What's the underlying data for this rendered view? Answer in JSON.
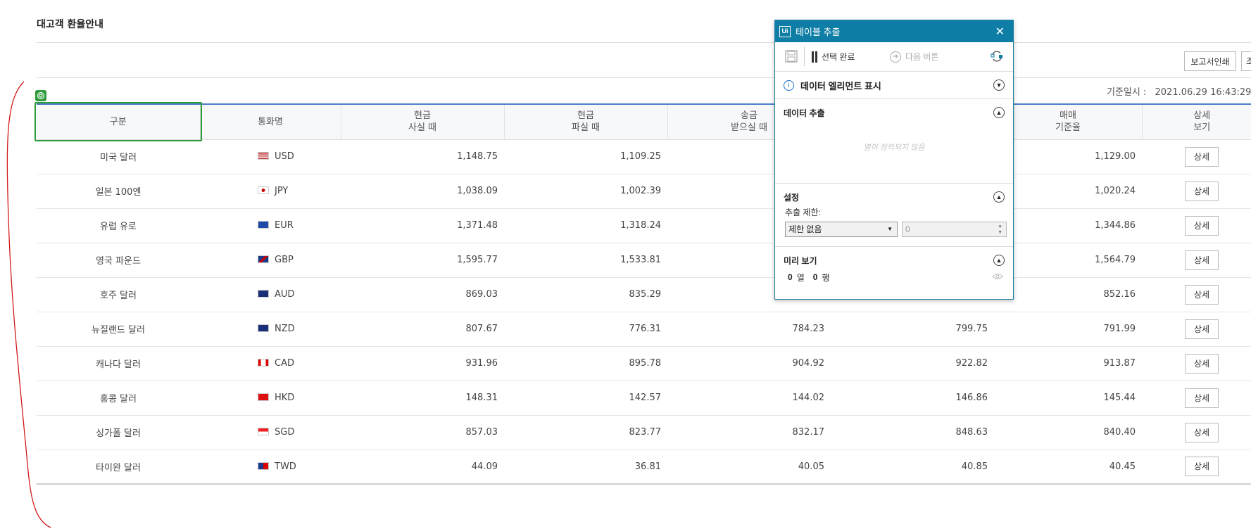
{
  "page": {
    "title": "대고객 환율안내",
    "print_button": "보고서인쇄",
    "cut_button": "조",
    "base_date_label": "기준일시 :",
    "base_date_value": "2021.06.29 16:43:29 ("
  },
  "table": {
    "headers": [
      {
        "line1": "구분",
        "line2": ""
      },
      {
        "line1": "통화명",
        "line2": ""
      },
      {
        "line1": "현금",
        "line2": "사실 때"
      },
      {
        "line1": "현금",
        "line2": "파실 때"
      },
      {
        "line1": "송금",
        "line2": "받으실 때"
      },
      {
        "line1": "",
        "line2": ""
      },
      {
        "line1": "매매",
        "line2": "기준율"
      },
      {
        "line1": "상세",
        "line2": "보기"
      }
    ],
    "rows": [
      {
        "name": "미국 달러",
        "code": "USD",
        "flag": "us-flag",
        "buy": "1,148.75",
        "sell": "1,109.25",
        "send": "",
        "recv": "",
        "base": "1,129.00",
        "detail": "상세"
      },
      {
        "name": "일본 100엔",
        "code": "JPY",
        "flag": "jp-flag",
        "buy": "1,038.09",
        "sell": "1,002.39",
        "send": "",
        "recv": "",
        "base": "1,020.24",
        "detail": "상세"
      },
      {
        "name": "유럽 유로",
        "code": "EUR",
        "flag": "eu-flag",
        "buy": "1,371.48",
        "sell": "1,318.24",
        "send": "",
        "recv": "",
        "base": "1,344.86",
        "detail": "상세"
      },
      {
        "name": "영국 파운드",
        "code": "GBP",
        "flag": "gb-flag",
        "buy": "1,595.77",
        "sell": "1,533.81",
        "send": "",
        "recv": "",
        "base": "1,564.79",
        "detail": "상세"
      },
      {
        "name": "호주 달러",
        "code": "AUD",
        "flag": "au-flag",
        "buy": "869.03",
        "sell": "835.29",
        "send": "",
        "recv": "",
        "base": "852.16",
        "detail": "상세"
      },
      {
        "name": "뉴질랜드 달러",
        "code": "NZD",
        "flag": "nz-flag",
        "buy": "807.67",
        "sell": "776.31",
        "send": "784.23",
        "recv": "799.75",
        "base": "791.99",
        "detail": "상세"
      },
      {
        "name": "캐나다 달러",
        "code": "CAD",
        "flag": "ca-flag",
        "buy": "931.96",
        "sell": "895.78",
        "send": "904.92",
        "recv": "922.82",
        "base": "913.87",
        "detail": "상세"
      },
      {
        "name": "홍콩 달러",
        "code": "HKD",
        "flag": "hk-flag",
        "buy": "148.31",
        "sell": "142.57",
        "send": "144.02",
        "recv": "146.86",
        "base": "145.44",
        "detail": "상세"
      },
      {
        "name": "싱가폴 달러",
        "code": "SGD",
        "flag": "sg-flag",
        "buy": "857.03",
        "sell": "823.77",
        "send": "832.17",
        "recv": "848.63",
        "base": "840.40",
        "detail": "상세"
      },
      {
        "name": "타이완 달러",
        "code": "TWD",
        "flag": "tw-flag",
        "buy": "44.09",
        "sell": "36.81",
        "send": "40.05",
        "recv": "40.85",
        "base": "40.45",
        "detail": "상세"
      }
    ]
  },
  "dialog": {
    "logo": "Ui",
    "title": "테이블 추출",
    "close_icon": "close-icon",
    "toolbar": {
      "save_icon": "save-icon",
      "finish_label": "선택 완료",
      "next_label": "다음 버튼",
      "refresh_icon": "refresh-icon"
    },
    "sections": {
      "show_elements": "데이터 엘리먼트 표시",
      "extract": "데이터 추출",
      "extract_empty": "열이 정의되지 않음",
      "settings": "설정",
      "limit_label": "추출 제한:",
      "limit_value": "제한 없음",
      "limit_number": "0",
      "preview": "미리 보기",
      "preview_cols": "0",
      "preview_cols_label": "열",
      "preview_rows": "0",
      "preview_rows_label": "행"
    }
  },
  "colors": {
    "accent_blue": "#4a7fc9",
    "dialog_blue": "#0f7ea6",
    "selection_green": "#2e9b3a",
    "annotation_red": "#d11a1a"
  }
}
